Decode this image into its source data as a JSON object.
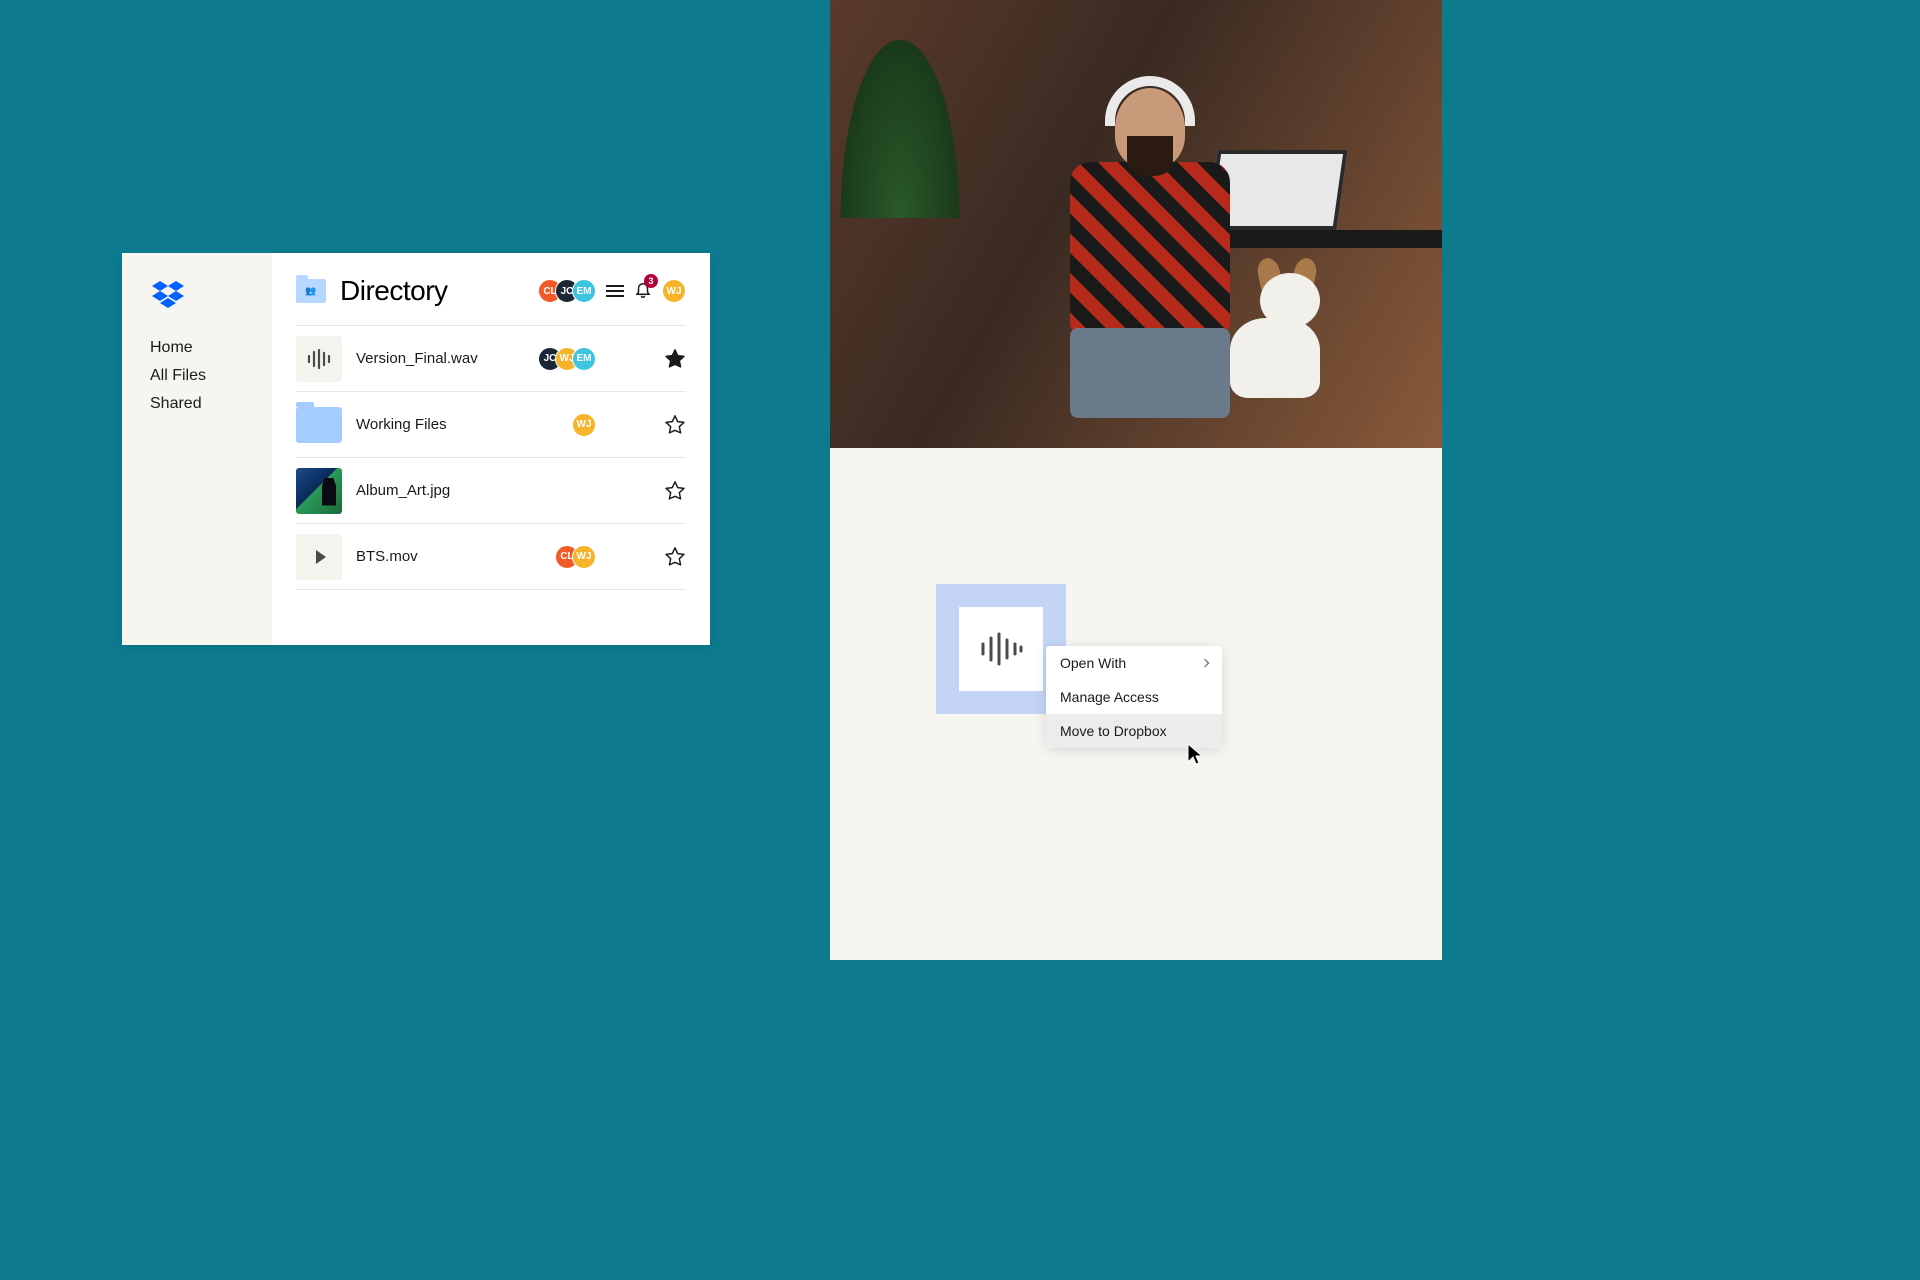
{
  "colors": {
    "brand_blue": "#0061ff",
    "cl": "#f25a29",
    "jc": "#1b2736",
    "em": "#3cc4e0",
    "wj": "#f5b429"
  },
  "sidebar": {
    "items": [
      {
        "label": "Home"
      },
      {
        "label": "All Files"
      },
      {
        "label": "Shared"
      }
    ]
  },
  "header": {
    "title": "Directory",
    "shared_with": [
      {
        "initials": "CL",
        "color": "#f25a29"
      },
      {
        "initials": "JC",
        "color": "#1b2736"
      },
      {
        "initials": "EM",
        "color": "#3cc4e0"
      }
    ],
    "notifications": 3,
    "me": {
      "initials": "WJ",
      "color": "#f5b429"
    }
  },
  "files": [
    {
      "name": "Version_Final.wav",
      "kind": "audio",
      "starred": true,
      "shared_with": [
        {
          "initials": "JC",
          "color": "#1b2736"
        },
        {
          "initials": "WJ",
          "color": "#f5b429"
        },
        {
          "initials": "EM",
          "color": "#3cc4e0"
        }
      ]
    },
    {
      "name": "Working Files",
      "kind": "folder",
      "starred": false,
      "shared_with": [
        {
          "initials": "WJ",
          "color": "#f5b429"
        }
      ]
    },
    {
      "name": "Album_Art.jpg",
      "kind": "image",
      "starred": false,
      "shared_with": []
    },
    {
      "name": "BTS.mov",
      "kind": "video",
      "starred": false,
      "shared_with": [
        {
          "initials": "CL",
          "color": "#f25a29"
        },
        {
          "initials": "WJ",
          "color": "#f5b429"
        }
      ]
    }
  ],
  "context_menu": {
    "items": [
      {
        "label": "Open With",
        "has_submenu": true
      },
      {
        "label": "Manage Access",
        "has_submenu": false
      },
      {
        "label": "Move to Dropbox",
        "has_submenu": false
      }
    ],
    "hovered_index": 2
  }
}
